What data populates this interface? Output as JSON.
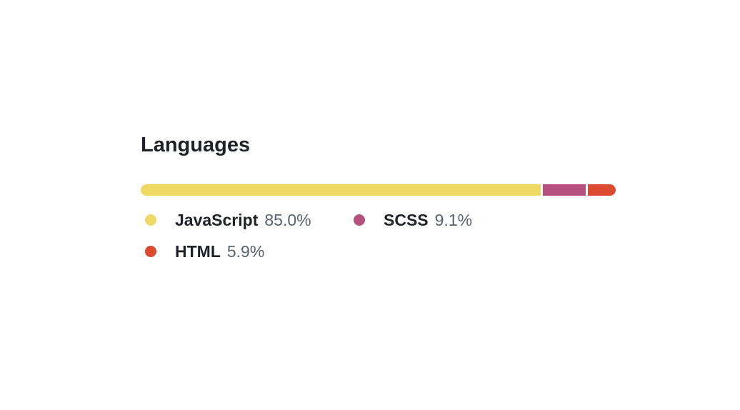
{
  "section": {
    "title": "Languages"
  },
  "languages": [
    {
      "name": "JavaScript",
      "percent_label": "85.0%",
      "percent": 85.0,
      "color": "#efd965"
    },
    {
      "name": "SCSS",
      "percent_label": "9.1%",
      "percent": 9.1,
      "color": "#b4517f"
    },
    {
      "name": "HTML",
      "percent_label": "5.9%",
      "percent": 5.9,
      "color": "#dc4b2f"
    }
  ]
}
